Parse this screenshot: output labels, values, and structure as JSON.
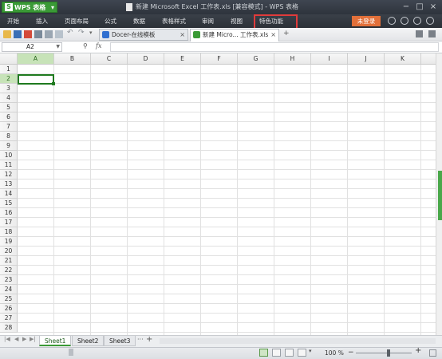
{
  "app": {
    "button_label": "WPS 表格",
    "logo_letter": "S"
  },
  "window": {
    "title": "新建 Microsoft Excel 工作表.xls [兼容模式] - WPS 表格"
  },
  "menu": {
    "items": [
      "开始",
      "插入",
      "页面布局",
      "公式",
      "数据",
      "表格样式",
      "审阅",
      "视图",
      "特色功能"
    ],
    "login_label": "未登录"
  },
  "doc_tabs": [
    {
      "label": "Docer-在线模板",
      "close": "×"
    },
    {
      "label": "新建 Micro... 工作表.xls",
      "close": "×"
    }
  ],
  "new_tab": "+",
  "formula_bar": {
    "name_box": "A2",
    "fx": "fx",
    "formula": ""
  },
  "grid": {
    "columns": [
      "A",
      "B",
      "C",
      "D",
      "E",
      "F",
      "G",
      "H",
      "I",
      "J",
      "K"
    ],
    "rows": [
      "1",
      "2",
      "3",
      "4",
      "5",
      "6",
      "7",
      "8",
      "9",
      "10",
      "11",
      "12",
      "13",
      "14",
      "15",
      "16",
      "17",
      "18",
      "19",
      "20",
      "21",
      "22",
      "23",
      "24",
      "25",
      "26",
      "27",
      "28"
    ],
    "selected_column": "A",
    "selected_row": "2"
  },
  "sheets": {
    "names": [
      "Sheet1",
      "Sheet2",
      "Sheet3"
    ],
    "active": "Sheet1",
    "more": "···",
    "add": "+"
  },
  "status": {
    "zoom": "100 %",
    "zoom_out": "−",
    "zoom_in": "+"
  },
  "colors": {
    "accent_green": "#3a9a36",
    "annotation_red": "#e03b3b",
    "login_orange": "#e2703a"
  }
}
